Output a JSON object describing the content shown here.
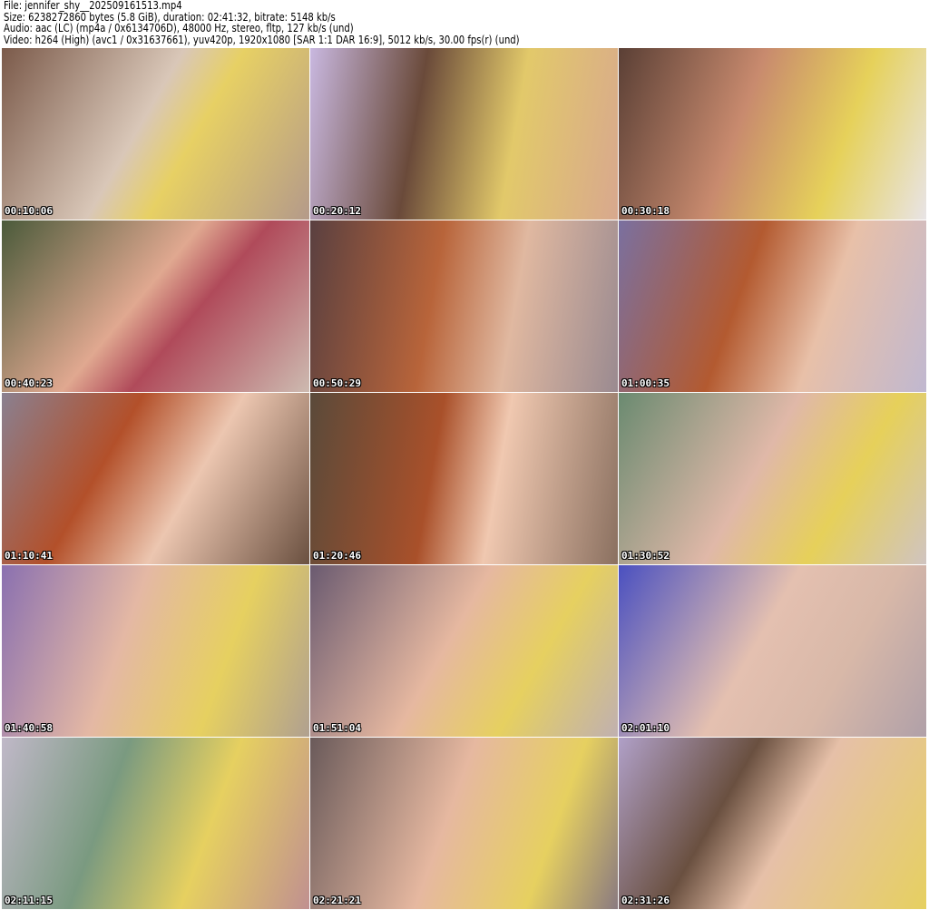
{
  "header": {
    "file": "File: jennifer_shy__202509161513.mp4",
    "size": "Size: 6238272860 bytes (5.8 GiB), duration: 02:41:32, bitrate: 5148 kb/s",
    "audio": "Audio: aac (LC) (mp4a / 0x6134706D), 48000 Hz, stereo, fltp, 127 kb/s (und)",
    "video": "Video: h264 (High) (avc1 / 0x31637661), yuv420p, 1920x1080 [SAR 1:1 DAR 16:9], 5012 kb/s, 30.00 fps(r) (und)"
  },
  "thumbnails": [
    {
      "timestamp": "00:10:06"
    },
    {
      "timestamp": "00:20:12"
    },
    {
      "timestamp": "00:30:18"
    },
    {
      "timestamp": "00:40:23"
    },
    {
      "timestamp": "00:50:29"
    },
    {
      "timestamp": "01:00:35"
    },
    {
      "timestamp": "01:10:41"
    },
    {
      "timestamp": "01:20:46"
    },
    {
      "timestamp": "01:30:52"
    },
    {
      "timestamp": "01:40:58"
    },
    {
      "timestamp": "01:51:04"
    },
    {
      "timestamp": "02:01:10"
    },
    {
      "timestamp": "02:11:15"
    },
    {
      "timestamp": "02:21:21"
    },
    {
      "timestamp": "02:31:26"
    }
  ]
}
